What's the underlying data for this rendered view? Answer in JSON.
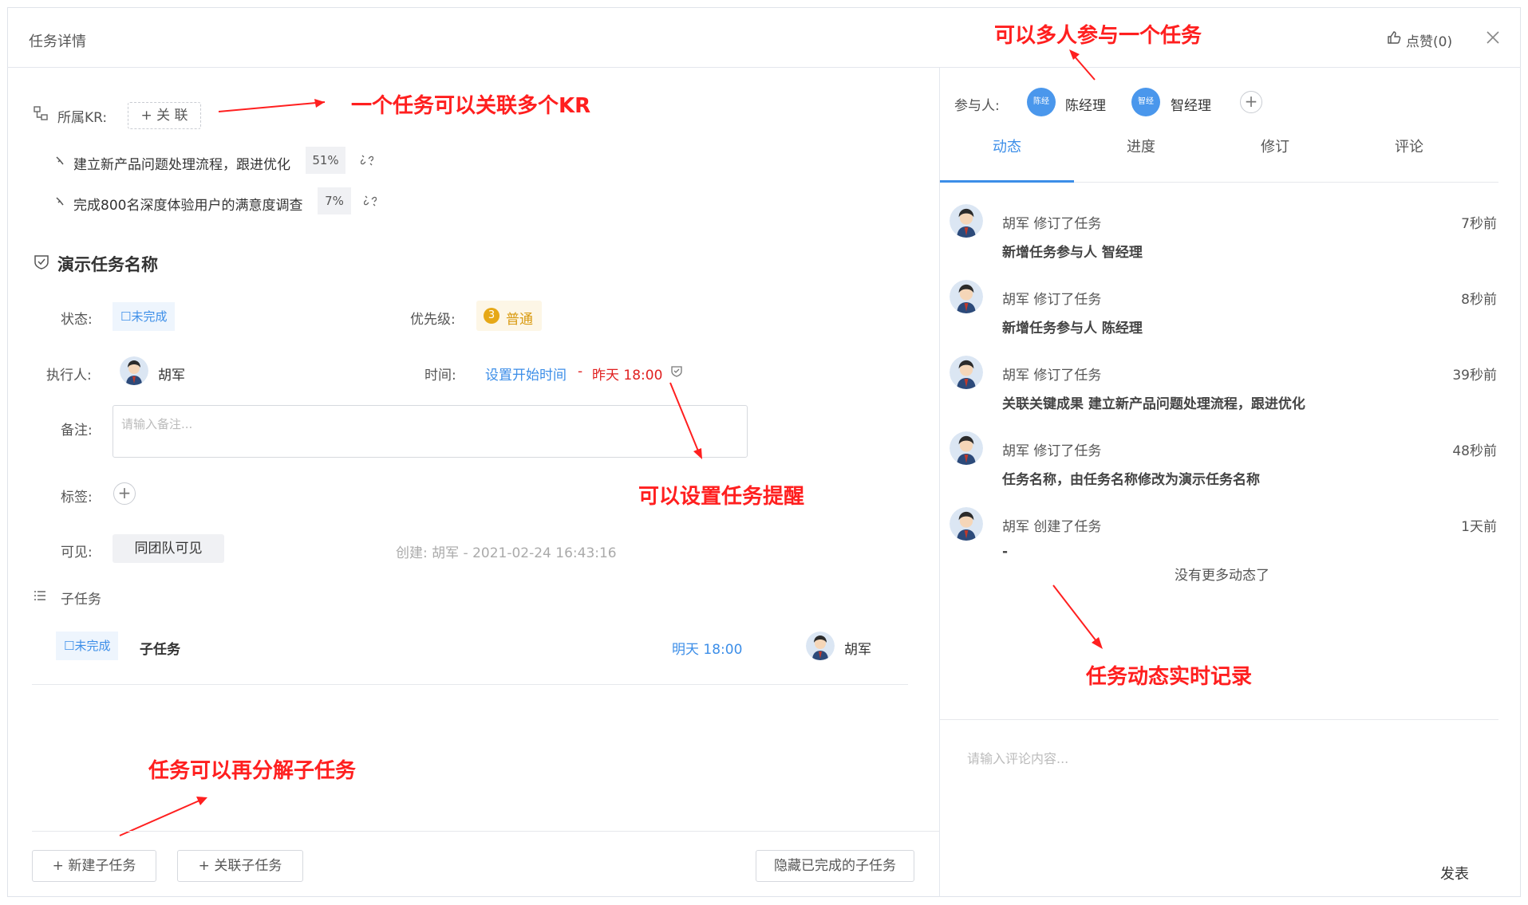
{
  "header": {
    "title": "任务详情",
    "like_label": "点赞(0)",
    "close_icon": "close-icon"
  },
  "kr": {
    "label": "所属KR:",
    "link_button": "+ 关 联",
    "items": [
      {
        "text": "建立新产品问题处理流程，跟进优化",
        "percent": "51%"
      },
      {
        "text": "完成800名深度体验用户的满意度调查",
        "percent": "7%"
      }
    ]
  },
  "task": {
    "name": "演示任务名称",
    "status_label": "状态:",
    "status_value": "☐未完成",
    "priority_label": "优先级:",
    "priority_number": "3",
    "priority_value": "普通",
    "assignee_label": "执行人:",
    "assignee_name": "胡军",
    "time_label": "时间:",
    "time_start": "设置开始时间",
    "time_sep": "-",
    "time_end": "昨天 18:00",
    "note_label": "备注:",
    "note_placeholder": "请输入备注...",
    "tags_label": "标签:",
    "visible_label": "可见:",
    "visible_value": "同团队可见",
    "created_info": "创建:  胡军 - 2021-02-24 16:43:16"
  },
  "subtasks": {
    "title": "子任务",
    "items": [
      {
        "status": "☐未完成",
        "name": "子任务",
        "due": "明天 18:00",
        "assignee": "胡军"
      }
    ],
    "new_button": "+  新建子任务",
    "link_button": "+  关联子任务",
    "hide_button": "隐藏已完成的子任务"
  },
  "participants": {
    "label": "参与人:",
    "people": [
      {
        "avatar_text": "陈经",
        "name": "陈经理"
      },
      {
        "avatar_text": "智经",
        "name": "智经理"
      }
    ]
  },
  "tabs": [
    "动态",
    "进度",
    "修订",
    "评论"
  ],
  "activity": {
    "items": [
      {
        "actor": "胡军 修订了任务",
        "time": "7秒前",
        "detail": "新增任务参与人 智经理"
      },
      {
        "actor": "胡军 修订了任务",
        "time": "8秒前",
        "detail": "新增任务参与人 陈经理"
      },
      {
        "actor": "胡军 修订了任务",
        "time": "39秒前",
        "detail": "关联关键成果 建立新产品问题处理流程，跟进优化"
      },
      {
        "actor": "胡军 修订了任务",
        "time": "48秒前",
        "detail": "任务名称，由任务名称修改为演示任务名称"
      },
      {
        "actor": "胡军 创建了任务",
        "time": "1天前",
        "detail": "-"
      }
    ],
    "no_more": "没有更多动态了"
  },
  "comment": {
    "placeholder": "请输入评论内容...",
    "submit": "发表"
  },
  "annotations": {
    "multi_kr": "一个任务可以关联多个KR",
    "multi_people": "可以多人参与一个任务",
    "reminder": "可以设置任务提醒",
    "activity_log": "任务动态实时记录",
    "subtask_split": "任务可以再分解子任务"
  },
  "colors": {
    "accent": "#3c8ee8",
    "annotation": "#ff1f1f",
    "priority": "#e6a817"
  }
}
